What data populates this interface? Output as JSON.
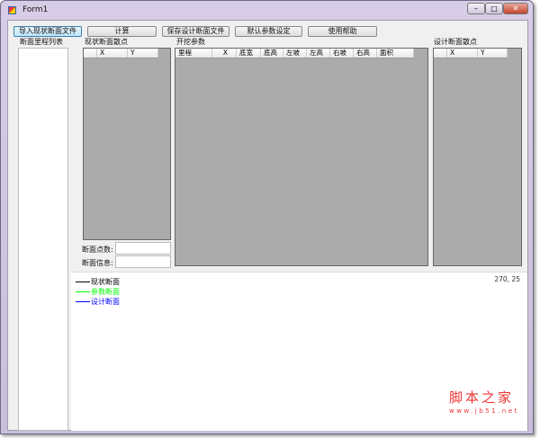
{
  "window": {
    "title": "Form1"
  },
  "toolbar": {
    "import": "导入现状断面文件",
    "calc": "计算",
    "save": "保存设计断面文件",
    "defaults": "默认参数设定",
    "help": "使用帮助"
  },
  "sections": {
    "mileage_list": "断面里程列表",
    "current_points": "现状断面散点",
    "excavation": "开挖参数",
    "design_points": "设计断面散点"
  },
  "current_grid": {
    "columns": [
      "X",
      "Y"
    ]
  },
  "excavation_grid": {
    "columns": [
      "里程",
      "X",
      "底宽",
      "底高",
      "左坡",
      "左高",
      "右坡",
      "右高",
      "面积"
    ]
  },
  "design_grid": {
    "columns": [
      "X",
      "Y"
    ]
  },
  "info": {
    "point_count_label": "断面点数:",
    "point_count_value": "",
    "section_info_label": "断面信息:",
    "section_info_value": ""
  },
  "chart": {
    "coords": "270, 25",
    "legend": [
      {
        "label": "现状断面",
        "color": "#000000"
      },
      {
        "label": "参数断面",
        "color": "#00ff00"
      },
      {
        "label": "设计断面",
        "color": "#0000ff"
      }
    ]
  },
  "watermark": {
    "name": "脚本之家",
    "url": "www.jb51.net"
  }
}
